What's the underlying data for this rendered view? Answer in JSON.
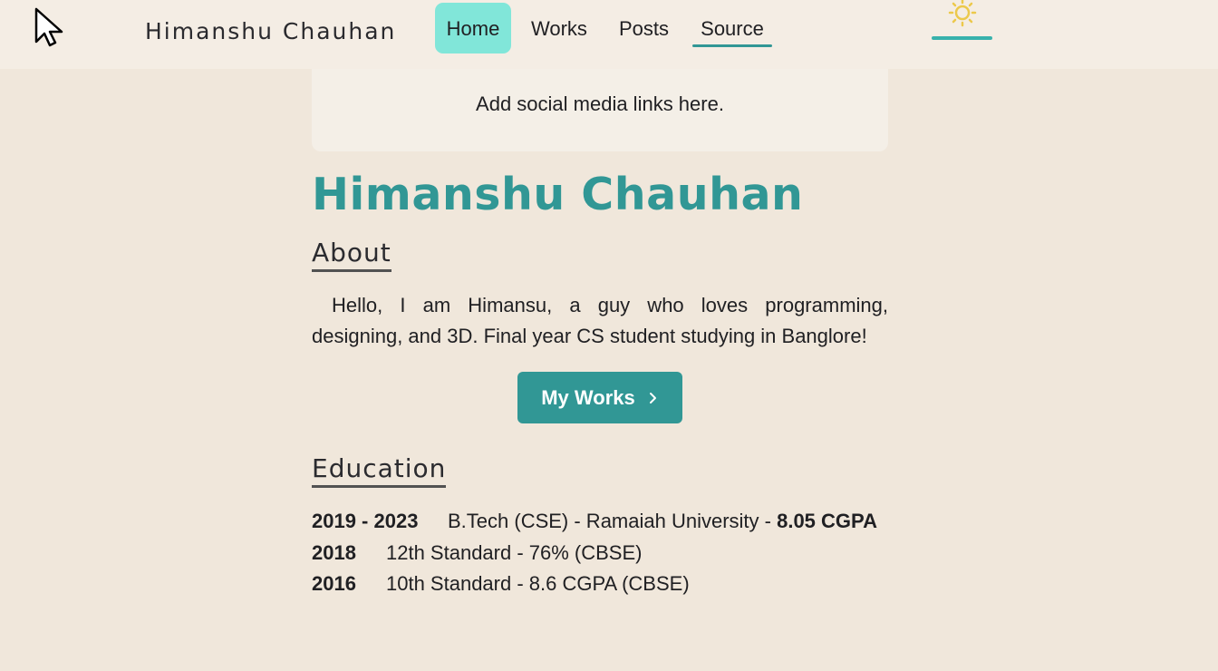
{
  "navbar": {
    "brand": "Himanshu Chauhan",
    "links": [
      {
        "label": "Home",
        "active": true
      },
      {
        "label": "Works"
      },
      {
        "label": "Posts"
      },
      {
        "label": "Source"
      }
    ],
    "theme_icon": "sun-icon"
  },
  "social": {
    "text": "Add social media links here."
  },
  "main": {
    "title": "Himanshu Chauhan",
    "about": {
      "heading": "About",
      "text": "Hello, I am Himansu, a guy who loves programming, designing, and 3D. Final year CS student studying in Banglore!"
    },
    "works_button": {
      "label": "My Works",
      "icon": "chevron-right-icon"
    },
    "education": {
      "heading": "Education",
      "items": [
        {
          "year": "2019 - 2023",
          "description": "B.Tech (CSE) - Ramaiah University - ",
          "grade": "8.05 CGPA"
        },
        {
          "year": "2018",
          "description": "12th Standard - 76% (CBSE)"
        },
        {
          "year": "2016",
          "description": "10th Standard - 8.6 CGPA (CBSE)"
        }
      ]
    }
  },
  "colors": {
    "background": "#f0e7db",
    "navbar": "#f4ede4",
    "accent": "#319795",
    "active_nav": "#81e6d9",
    "sun": "#ecc94b"
  }
}
